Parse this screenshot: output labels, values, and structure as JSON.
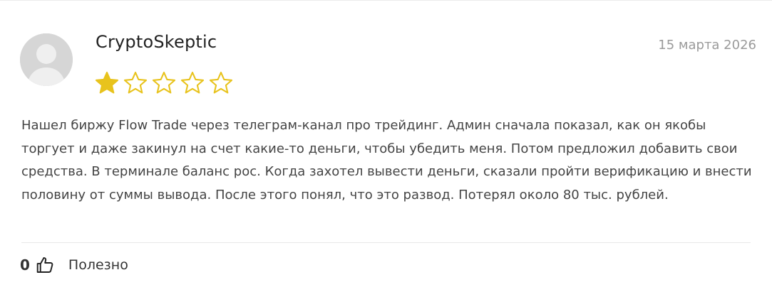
{
  "review": {
    "author": "CryptoSkeptic",
    "date": "15 марта 2026",
    "rating": 1,
    "rating_max": 5,
    "text": "Нашел биржу Flow Trade через телеграм-канал про трейдинг. Админ сначала показал, как он якобы торгует и даже закинул на счет какие-то деньги, чтобы убедить меня. Потом предложил добавить свои средства. В терминале баланс рос. Когда захотел вывести деньги, сказали пройти верификацию и внести половину от суммы вывода. После этого понял, что это развод. Потерял около 80 тыс. рублей.",
    "useful_count": "0",
    "useful_label": "Полезно"
  },
  "icons": {
    "avatar": "user-placeholder-icon",
    "star_filled": "star-filled-icon",
    "star_empty": "star-outline-icon",
    "useful": "thumbs-up-icon"
  },
  "colors": {
    "star": "#e8c31d",
    "avatar_bg": "#d6d6d6",
    "avatar_fg": "#efefef",
    "date": "#9a9a9a",
    "text": "#444444"
  }
}
